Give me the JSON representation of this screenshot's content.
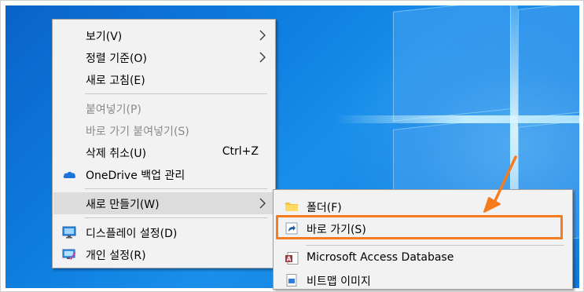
{
  "context_menu": {
    "items": [
      {
        "label": "보기(V)",
        "submenu": true,
        "disabled": false
      },
      {
        "label": "정렬 기준(O)",
        "submenu": true,
        "disabled": false
      },
      {
        "label": "새로 고침(E)",
        "submenu": false,
        "disabled": false
      },
      {
        "label": "붙여넣기(P)",
        "submenu": false,
        "disabled": true
      },
      {
        "label": "바로 가기 붙여넣기(S)",
        "submenu": false,
        "disabled": true
      },
      {
        "label": "삭제 취소(U)",
        "shortcut": "Ctrl+Z",
        "submenu": false,
        "disabled": false
      },
      {
        "label": "OneDrive 백업 관리",
        "icon": "onedrive-cloud-icon",
        "submenu": false,
        "disabled": false
      },
      {
        "label": "새로 만들기(W)",
        "submenu": true,
        "disabled": false,
        "hovered": true
      },
      {
        "label": "디스플레이 설정(D)",
        "icon": "display-settings-icon",
        "submenu": false,
        "disabled": false
      },
      {
        "label": "개인 설정(R)",
        "icon": "personalize-icon",
        "submenu": false,
        "disabled": false
      }
    ]
  },
  "new_submenu": {
    "items": [
      {
        "label": "폴더(F)",
        "icon": "folder-icon"
      },
      {
        "label": "바로 가기(S)",
        "icon": "shortcut-icon",
        "highlighted": true
      },
      {
        "label": "Microsoft Access Database",
        "icon": "access-database-icon"
      },
      {
        "label": "비트맵 이미지",
        "icon": "bitmap-image-icon"
      }
    ]
  },
  "colors": {
    "desktop": "#0f7fe0",
    "menu_bg": "#f2f2f2",
    "hover": "#dcdcdc",
    "annotation": "#f47c1f",
    "disabled_text": "#8a8a8a"
  }
}
